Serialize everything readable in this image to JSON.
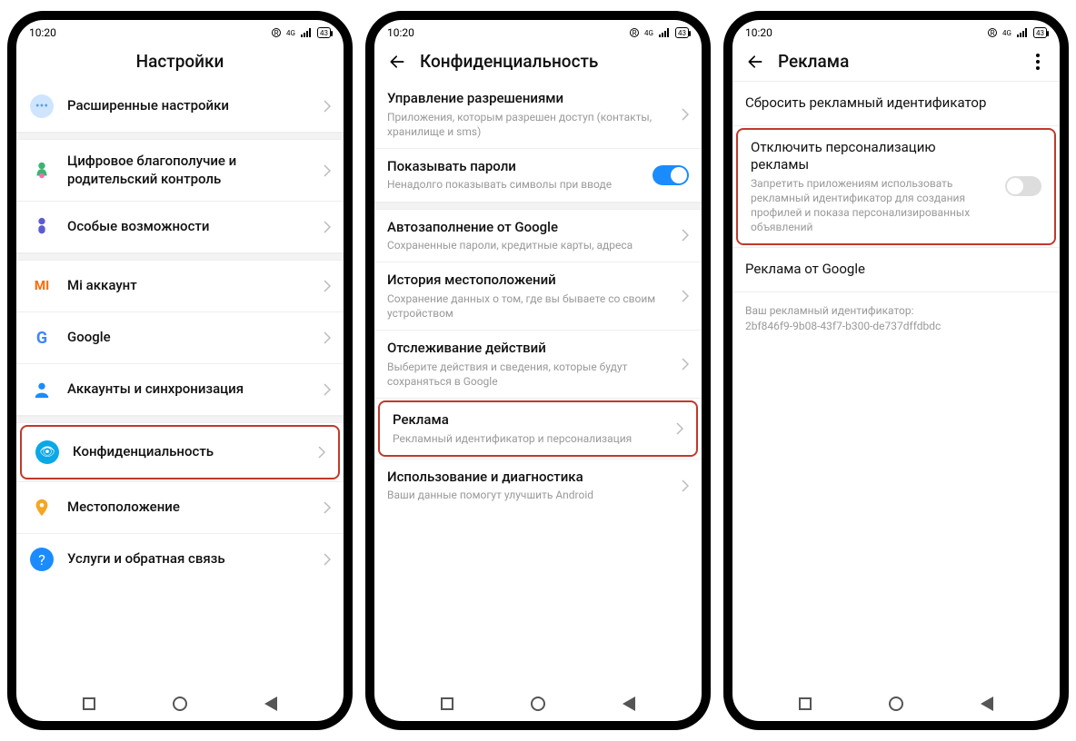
{
  "status": {
    "time": "10:20",
    "battery": "43"
  },
  "phone1": {
    "title": "Настройки",
    "items": [
      {
        "label": "Расширенные настройки"
      },
      {
        "label": "Цифровое благополучие и родительский контроль"
      },
      {
        "label": "Особые возможности"
      },
      {
        "label": "Mi аккаунт"
      },
      {
        "label": "Google"
      },
      {
        "label": "Аккаунты и синхронизация"
      },
      {
        "label": "Конфиденциальность"
      },
      {
        "label": "Местоположение"
      },
      {
        "label": "Услуги и обратная связь"
      }
    ]
  },
  "phone2": {
    "title": "Конфиденциальность",
    "items": [
      {
        "title": "Управление разрешениями",
        "sub": "Приложения, которым разрешен доступ (контакты, хранилище и sms)"
      },
      {
        "title": "Показывать пароли",
        "sub": "Ненадолго показывать символы при вводе"
      },
      {
        "title": "Автозаполнение от Google",
        "sub": "Сохраненные пароли, кредитные карты, адреса"
      },
      {
        "title": "История местоположений",
        "sub": "Сохранение данных о том, где вы бываете со своим устройством"
      },
      {
        "title": "Отслеживание действий",
        "sub": "Выберите действия и сведения, которые будут сохраняться в Google"
      },
      {
        "title": "Реклама",
        "sub": "Рекламный идентификатор и персонализация"
      },
      {
        "title": "Использование и диагностика",
        "sub": "Ваши данные помогут улучшить Android"
      }
    ]
  },
  "phone3": {
    "title": "Реклама",
    "items": [
      {
        "title": "Сбросить рекламный идентификатор"
      },
      {
        "title": "Отключить персонализацию рекламы",
        "sub": "Запретить приложениям использовать рекламный идентификатор для создания профилей и показа персонализированных объявлений"
      },
      {
        "title": "Реклама от Google"
      }
    ],
    "info_label": "Ваш рекламный идентификатор:",
    "info_value": "2bf846f9-9b08-43f7-b300-de737dffdbdc"
  }
}
